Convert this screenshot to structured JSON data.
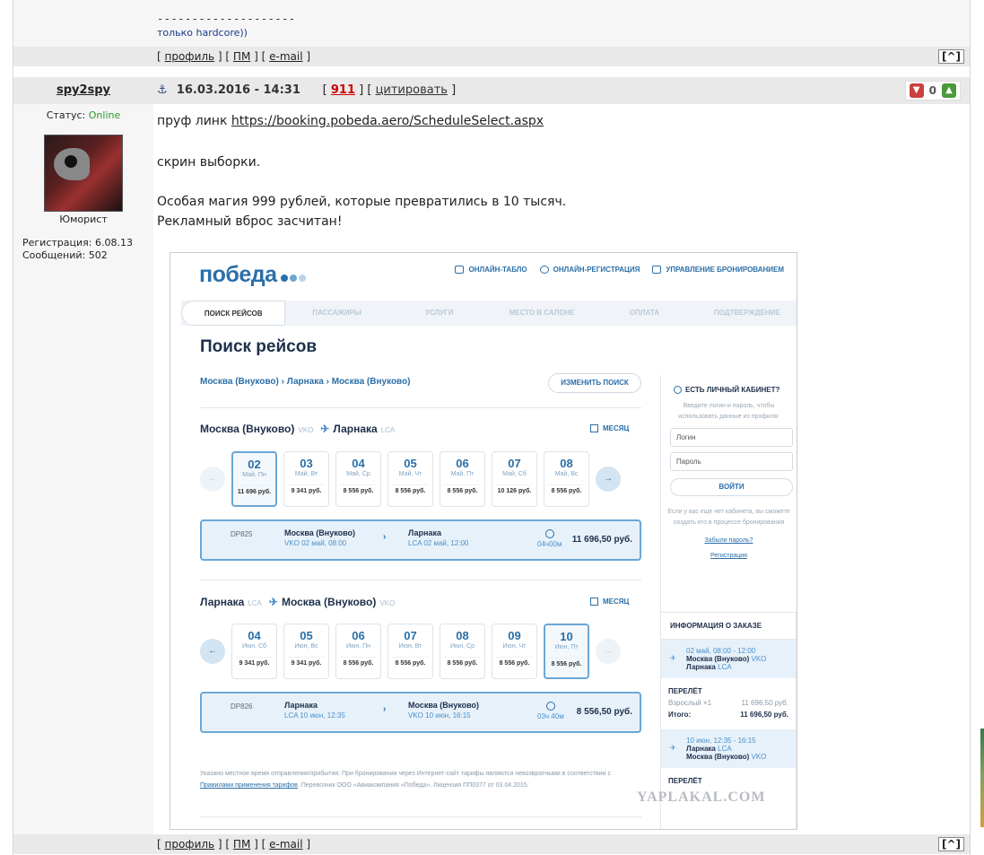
{
  "signature": {
    "dashes": "--------------------",
    "quote": "только hardcore))"
  },
  "footer": {
    "profile": "профиль",
    "pm": "ПМ",
    "email": "e-mail",
    "up": "[^]"
  },
  "post": {
    "author": "spy2spy",
    "status_label": "Статус:",
    "status_value": "Online",
    "rank": "Юморист",
    "registration": "Регистрация: 6.08.13",
    "messages": "Сообщений: 502",
    "date": "16.03.2016 - 14:31",
    "rating": "911",
    "quote_label": "цитировать",
    "votes": "0",
    "line1_prefix": "пруф линк ",
    "line1_link": "https://booking.pobeda.aero/ScheduleSelect.aspx",
    "line2": "скрин выборки.",
    "line3": "Особая магия 999 рублей, которые превратились в 10 тысяч.",
    "line4": "Рекламный вброс засчитан!"
  },
  "screenshot": {
    "logo": "победа",
    "logo_colors": [
      "#2a6fa8",
      "#6aa7d6",
      "#b9d3ea"
    ],
    "top_links": [
      "ОНЛАЙН-ТАБЛО",
      "ОНЛАЙН-РЕГИСТРАЦИЯ",
      "УПРАВЛЕНИЕ БРОНИРОВАНИЕМ"
    ],
    "steps": [
      "ПОИСК РЕЙСОВ",
      "ПАССАЖИРЫ",
      "УСЛУГИ",
      "МЕСТО В САЛОНЕ",
      "ОПЛАТА",
      "ПОДТВЕРЖДЕНИЕ"
    ],
    "title": "Поиск рейсов",
    "route": "Москва (Внуково)  ›  Ларнака  ›  Москва (Внуково)",
    "change_search": "ИЗМЕНИТЬ ПОИСК",
    "month": "МЕСЯЦ",
    "outbound": {
      "from": "Москва (Внуково)",
      "from_code": "VKO",
      "to": "Ларнака",
      "to_code": "LCA",
      "days": [
        {
          "num": "02",
          "dow": "Май, Пн",
          "price": "11 696 руб."
        },
        {
          "num": "03",
          "dow": "Май, Вт",
          "price": "9 341 руб."
        },
        {
          "num": "04",
          "dow": "Май, Ср",
          "price": "8 556 руб."
        },
        {
          "num": "05",
          "dow": "Май, Чт",
          "price": "8 556 руб."
        },
        {
          "num": "06",
          "dow": "Май, Пт",
          "price": "8 556 руб."
        },
        {
          "num": "07",
          "dow": "Май, Сб",
          "price": "10 126 руб."
        },
        {
          "num": "08",
          "dow": "Май, Вс",
          "price": "8 556 руб."
        }
      ],
      "flight_no": "DP825",
      "dep_city": "Москва (Внуково)",
      "dep_time": "VKO 02 май, 08:00",
      "arr_city": "Ларнака",
      "arr_time": "LCA 02 май, 12:00",
      "duration": "04ч00м",
      "total": "11 696,50 руб."
    },
    "inbound": {
      "from": "Ларнака",
      "from_code": "LCA",
      "to": "Москва (Внуково)",
      "to_code": "VKO",
      "days": [
        {
          "num": "04",
          "dow": "Июн, Сб",
          "price": "9 341 руб."
        },
        {
          "num": "05",
          "dow": "Июн, Вс",
          "price": "9 341 руб."
        },
        {
          "num": "06",
          "dow": "Июн, Пн",
          "price": "8 556 руб."
        },
        {
          "num": "07",
          "dow": "Июн, Вт",
          "price": "8 556 руб."
        },
        {
          "num": "08",
          "dow": "Июн, Ср",
          "price": "8 556 руб."
        },
        {
          "num": "09",
          "dow": "Июн, Чт",
          "price": "8 556 руб."
        },
        {
          "num": "10",
          "dow": "Июн, Пт",
          "price": "8 556 руб."
        }
      ],
      "flight_no": "DP826",
      "dep_city": "Ларнака",
      "dep_time": "LCA 10 июн, 12:35",
      "arr_city": "Москва (Внуково)",
      "arr_time": "VKO 10 июн, 16:15",
      "duration": "03ч 40м",
      "total": "8 556,50 руб."
    },
    "footnote_1": "Указано местное время отправления/прибытия. При бронировании через Интернет-сайт тарифы являются невозвратными в соответствии с ",
    "footnote_link": "Правилами применения тарифов",
    "footnote_2": ". Перевозчик ООО «Авиакомпания «Победа». Лицензия ПП0377 от 03.04.2015.",
    "sidebar": {
      "title": "ЕСТЬ ЛИЧНЫЙ КАБИНЕТ?",
      "hint": "Введите логин и пароль, чтобы использовать данные из профиля:",
      "login": "Логин",
      "password": "Пароль",
      "submit": "ВОЙТИ",
      "no_account": "Если у вас еще нет кабинета, вы сможете создать его в процессе бронирования",
      "forgot": "Забыли пароль?",
      "register": "Регистрация"
    },
    "order": {
      "title": "ИНФОРМАЦИЯ О ЗАКАЗЕ",
      "seg1_time": "02 май, 08:00 - 12:00",
      "seg1_from": "Москва (Внуково)",
      "seg1_from_code": "VKO",
      "seg1_to": "Ларнака",
      "seg1_to_code": "LCA",
      "flight_label": "ПЕРЕЛЁТ",
      "adult": "Взрослый ×1",
      "adult_price": "11 696,50 руб.",
      "total_label": "Итого:",
      "total_price": "11 696,50 руб.",
      "seg2_time": "10 июн, 12:35 - 16:15",
      "seg2_from": "Ларнака",
      "seg2_from_code": "LCA",
      "seg2_to": "Москва (Внуково)",
      "seg2_to_code": "VKO",
      "flight_label_2": "ПЕРЕЛЁТ"
    },
    "watermark": "YAPLAKAL.COM"
  }
}
